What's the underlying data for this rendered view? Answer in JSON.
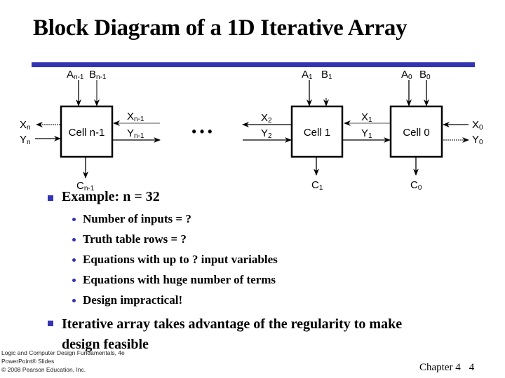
{
  "slide": {
    "title": "Block Diagram of a 1D Iterative Array",
    "accent_color": "#3333b3"
  },
  "diagram": {
    "cells": [
      {
        "label": "Cell n-1",
        "inputs_top": [
          {
            "base": "A",
            "sub": "n-1"
          },
          {
            "base": "B",
            "sub": "n-1"
          }
        ],
        "output_bottom": {
          "base": "C",
          "sub": "n-1"
        }
      },
      {
        "label": "Cell 1",
        "inputs_top": [
          {
            "base": "A",
            "sub": "1"
          },
          {
            "base": "B",
            "sub": "1"
          }
        ],
        "output_bottom": {
          "base": "C",
          "sub": "1"
        }
      },
      {
        "label": "Cell 0",
        "inputs_top": [
          {
            "base": "A",
            "sub": "0"
          },
          {
            "base": "B",
            "sub": "0"
          }
        ],
        "output_bottom": {
          "base": "C",
          "sub": "0"
        }
      }
    ],
    "signals": {
      "xn": {
        "base": "X",
        "sub": "n"
      },
      "yn": {
        "base": "Y",
        "sub": "n"
      },
      "xn1": {
        "base": "X",
        "sub": "n-1"
      },
      "yn1": {
        "base": "Y",
        "sub": "n-1"
      },
      "x2": {
        "base": "X",
        "sub": "2"
      },
      "y2": {
        "base": "Y",
        "sub": "2"
      },
      "x1": {
        "base": "X",
        "sub": "1"
      },
      "y1": {
        "base": "Y",
        "sub": "1"
      },
      "x0": {
        "base": "X",
        "sub": "0"
      },
      "y0": {
        "base": "Y",
        "sub": "0"
      }
    },
    "ellipsis": "• • •"
  },
  "bullets": {
    "example": "Example: n = 32",
    "sub_items": [
      "Number of inputs = ?",
      "Truth table rows =  ?",
      "Equations with  up to ?  input variables",
      "Equations with huge number of terms",
      "Design impractical!"
    ],
    "conclusion": "Iterative array takes advantage of the regularity to make design feasible"
  },
  "footer": {
    "line1": "Logic and Computer Design Fundamentals, 4e",
    "line2": "PowerPoint® Slides",
    "line3": "© 2008 Pearson Education, Inc.",
    "chapter": "Chapter 4",
    "page": "4"
  }
}
